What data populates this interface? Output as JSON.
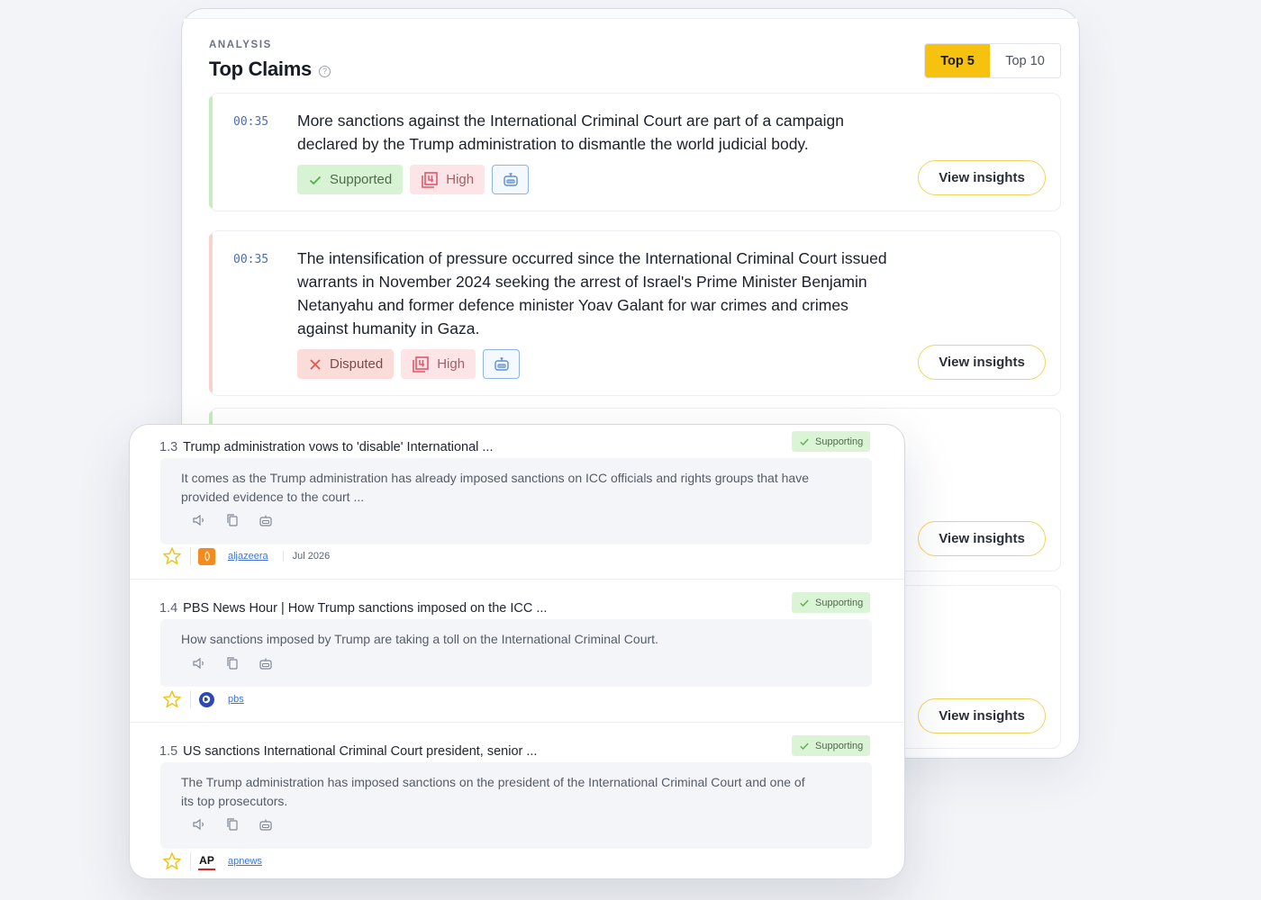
{
  "header": {
    "eyebrow": "ANALYSIS",
    "title": "Top Claims"
  },
  "segment": {
    "top5": "Top 5",
    "top10": "Top 10",
    "active": "Top 5"
  },
  "claims": [
    {
      "timestamp": "00:35",
      "text": "More sanctions against the International Criminal Court are part of a campaign declared by the Trump administration to dismantle the world judicial body.",
      "verdict": "Supported",
      "priority": "High",
      "status_color": "#c7ecc0"
    },
    {
      "timestamp": "00:35",
      "text": "The intensification of pressure occurred since the International Criminal Court issued warrants in November 2024 seeking the arrest of Israel's Prime Minister Benjamin Netanyahu and former defence minister Yoav Galant for war crimes and crimes against humanity in Gaza.",
      "verdict": "Disputed",
      "priority": "High",
      "status_color": "#f7d3cf"
    }
  ],
  "view_insights_label": "View insights",
  "sources": [
    {
      "num": "1.3",
      "title": "Trump administration vows to 'disable' International ...",
      "stance": "Supporting",
      "snippet": "It comes as the Trump administration has already imposed sanctions on ICC officials and rights groups that have provided evidence to the court ...",
      "source": "aljazeera",
      "date": "Jul 2026"
    },
    {
      "num": "1.4",
      "title": "PBS News Hour | How Trump sanctions imposed on the ICC ...",
      "stance": "Supporting",
      "snippet": "How sanctions imposed by Trump are taking a toll on the International Criminal Court.",
      "source": "pbs",
      "date": ""
    },
    {
      "num": "1.5",
      "title": "US sanctions International Criminal Court president, senior ...",
      "stance": "Supporting",
      "snippet": "The Trump administration has imposed sanctions on the president of the International Criminal Court and one of its top prosecutors.",
      "source": "apnews",
      "logo_text": "AP",
      "date": ""
    }
  ],
  "icons": {
    "help": "question-circle-icon",
    "supported": "check-icon",
    "disputed": "x-icon",
    "high": "priority-badge-icon",
    "bot": "robot-icon",
    "speaker": "speaker-icon",
    "copy": "copy-icon",
    "star": "star-icon"
  },
  "colors": {
    "accent": "#f6c20f",
    "supported_bg": "#d8f3d3",
    "disputed_bg": "#fbdcd9",
    "high_bg": "#fde4e6",
    "link": "#3f73d8"
  }
}
